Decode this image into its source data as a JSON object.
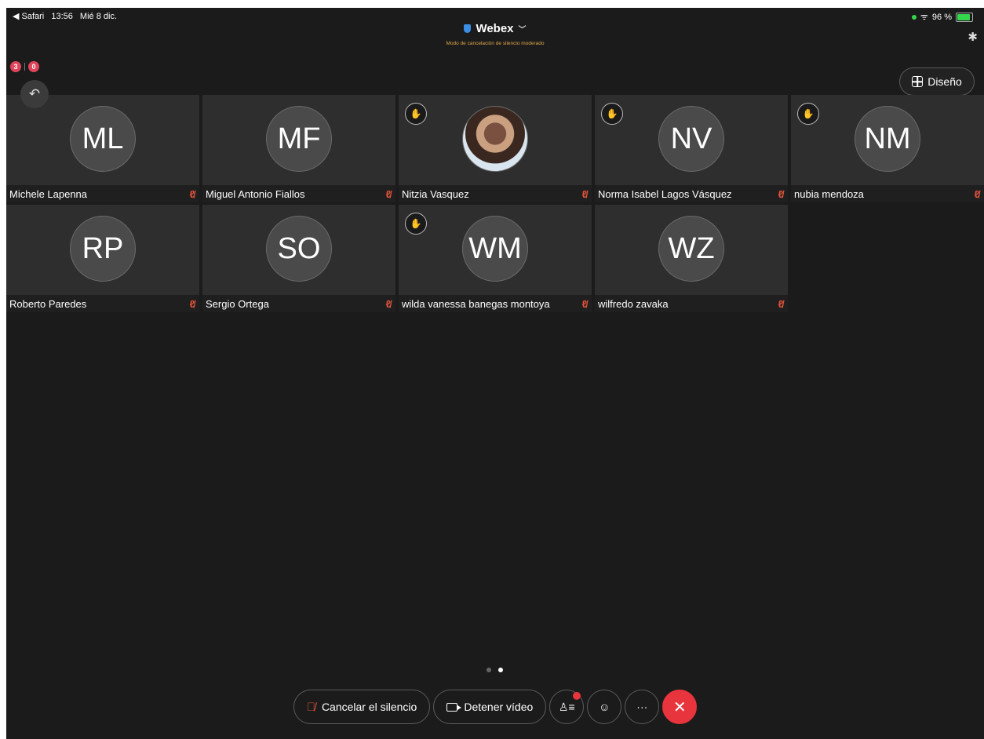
{
  "status_bar": {
    "back_app": "◀ Safari",
    "time": "13:56",
    "date": "Mié 8 dic.",
    "wifi": "ᯤ",
    "battery": "96 %"
  },
  "header": {
    "title": "Webex",
    "subtitle": "Modo de cancelación de silencio moderado"
  },
  "recording": {
    "badge1": "3",
    "badge2": "0"
  },
  "layout_button": {
    "label": "Diseño"
  },
  "participants": [
    {
      "initials": "ML",
      "name": "Michele Lapenna",
      "hand": false,
      "photo": false
    },
    {
      "initials": "MF",
      "name": "Miguel Antonio Fiallos",
      "hand": false,
      "photo": false
    },
    {
      "initials": "",
      "name": "Nitzia Vasquez",
      "hand": true,
      "photo": true
    },
    {
      "initials": "NV",
      "name": "Norma Isabel Lagos Vásquez",
      "hand": true,
      "photo": false
    },
    {
      "initials": "NM",
      "name": "nubia mendoza",
      "hand": true,
      "photo": false
    },
    {
      "initials": "RP",
      "name": "Roberto Paredes",
      "hand": false,
      "photo": false
    },
    {
      "initials": "SO",
      "name": "Sergio Ortega",
      "hand": false,
      "photo": false
    },
    {
      "initials": "WM",
      "name": "wilda vanessa banegas montoya",
      "hand": true,
      "photo": false
    },
    {
      "initials": "WZ",
      "name": "wilfredo zavaka",
      "hand": false,
      "photo": false
    }
  ],
  "pager": {
    "pages": 2,
    "active": 2
  },
  "controls": {
    "unmute": "Cancelar el silencio",
    "stop_video": "Detener vídeo"
  },
  "colors": {
    "background": "#1b1b1b",
    "tile": "#2e2e2e",
    "muted_mic": "#e0533a",
    "end_call": "#e8343d",
    "moderated_text": "#e0a64a"
  }
}
